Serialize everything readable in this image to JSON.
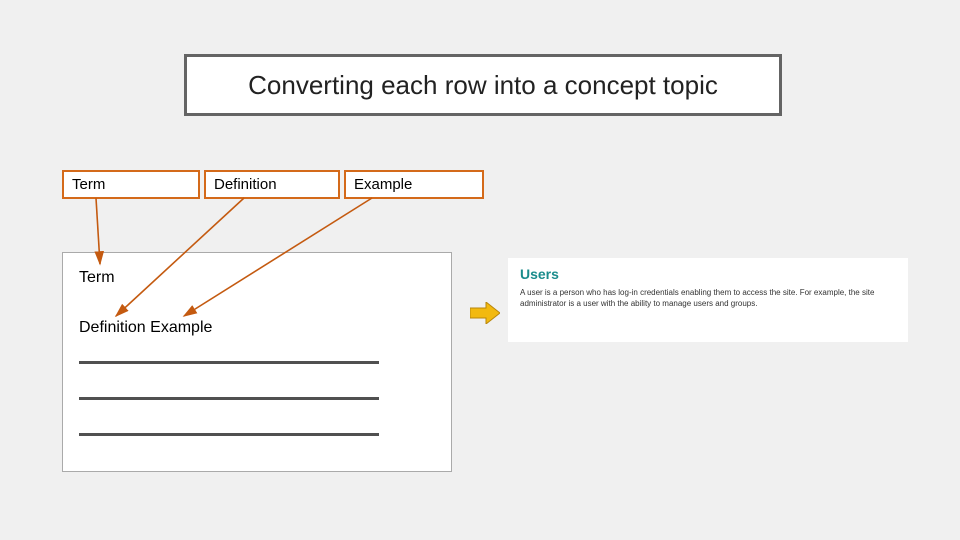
{
  "title": "Converting each row into a concept topic",
  "headers": {
    "term": "Term",
    "definition": "Definition",
    "example": "Example"
  },
  "topic": {
    "title_label": "Term",
    "body_labels": "Definition  Example"
  },
  "preview": {
    "heading": "Users",
    "body": "A user is a person who has log-in credentials enabling them to access the site. For example, the site administrator is a user with the ability to manage users and groups."
  }
}
